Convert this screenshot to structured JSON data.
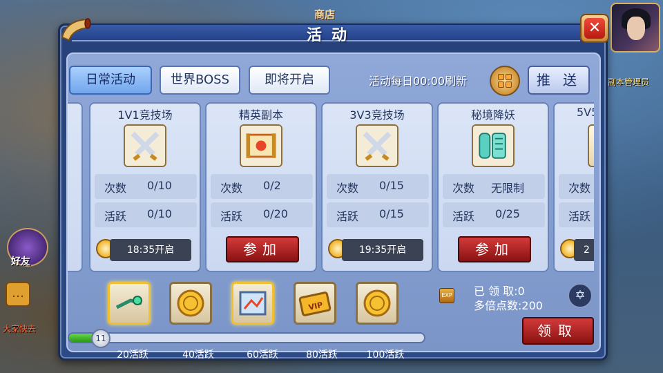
{
  "background": {
    "shop_sign": "商店",
    "friend_label": "好友",
    "right_text": "副本管理员",
    "chat_text": "大家快去"
  },
  "panel": {
    "title": "活动",
    "close_icon": "close-icon"
  },
  "tabs": [
    {
      "label": "日常活动",
      "active": true
    },
    {
      "label": "世界BOSS",
      "active": false
    },
    {
      "label": "即将开启",
      "active": false
    }
  ],
  "refresh": {
    "text": "活动每日00:00刷新",
    "push_label": "推 送"
  },
  "cards": [
    {
      "title": "1V1竞技场",
      "icon": "crossed-swords-icon",
      "count_label": "次数",
      "count": "0/10",
      "active_label": "活跃",
      "active": "0/10",
      "action": "time",
      "time": "18:35开启"
    },
    {
      "title": "精英副本",
      "icon": "scroll-map-icon",
      "count_label": "次数",
      "count": "0/2",
      "active_label": "活跃",
      "active": "0/20",
      "action": "join",
      "join_label": "参加"
    },
    {
      "title": "3V3竞技场",
      "icon": "crossed-swords-icon",
      "count_label": "次数",
      "count": "0/15",
      "active_label": "活跃",
      "active": "0/15",
      "action": "time",
      "time": "19:35开启"
    },
    {
      "title": "秘境降妖",
      "icon": "jade-scroll-icon",
      "count_label": "次数",
      "count": "无限制",
      "active_label": "活跃",
      "active": "0/25",
      "action": "join",
      "join_label": "参加"
    },
    {
      "title": "5V5",
      "count_label": "次数",
      "active_label": "活跃",
      "time": "2"
    }
  ],
  "rewards": [
    {
      "label": "20活跃",
      "icon": "green-gem-icon",
      "lit": true
    },
    {
      "label": "40活跃",
      "icon": "gold-coin-icon",
      "lit": false
    },
    {
      "label": "60活跃",
      "icon": "treasure-map-icon",
      "lit": true
    },
    {
      "label": "80活跃",
      "icon": "vip-card-icon",
      "lit": false
    },
    {
      "label": "100活跃",
      "icon": "gold-coin-icon",
      "lit": false
    }
  ],
  "progress": {
    "value": 11,
    "fraction": 0.09
  },
  "summary": {
    "claimed_text": "已 领 取:0",
    "multiplier_text": "多倍点数:200",
    "claim_label": "领取"
  },
  "colors": {
    "panel": "#2c4a85",
    "card": "#dbe5f7",
    "join_button": "#b82222",
    "progress_fill": "#2a9a18"
  }
}
